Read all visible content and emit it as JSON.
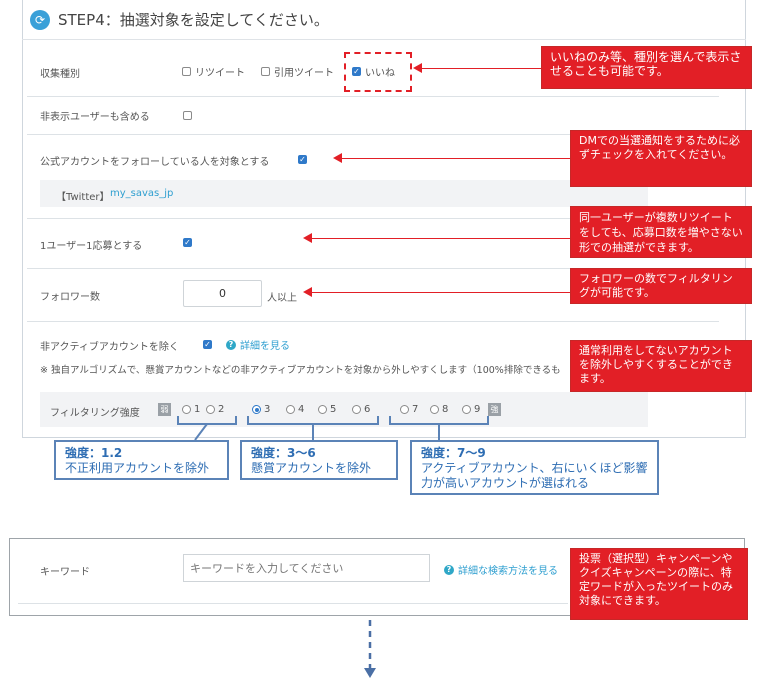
{
  "step": {
    "title": "STEP4：抽選対象を設定してください。"
  },
  "collection_type": {
    "label": "収集種別",
    "options": [
      {
        "label": "リツイート",
        "checked": false
      },
      {
        "label": "引用ツイート",
        "checked": false
      },
      {
        "label": "いいね",
        "checked": true
      }
    ]
  },
  "include_hidden": {
    "label": "非表示ユーザーも含める",
    "checked": false
  },
  "follow_official": {
    "label": "公式アカウントをフォローしている人を対象とする",
    "checked": true
  },
  "twitter": {
    "label": "【Twitter】",
    "handle": "my_savas_jp"
  },
  "one_entry": {
    "label": "1ユーザー1応募とする",
    "checked": true
  },
  "followers": {
    "label": "フォロワー数",
    "value": "0",
    "suffix": "人以上"
  },
  "inactive": {
    "label": "非アクティブアカウントを除く",
    "checked": true,
    "link": "詳細を見る",
    "note": "※ 独自アルゴリズムで、懸賞アカウントなどの非アクティブアカウントを対象から外しやすくします（100%排除できるも"
  },
  "filtering": {
    "label": "フィルタリング強度",
    "weak": "弱",
    "strong": "強",
    "levels": [
      "1",
      "2",
      "3",
      "4",
      "5",
      "6",
      "7",
      "8",
      "9"
    ],
    "selected": "3"
  },
  "keyword": {
    "label": "キーワード",
    "placeholder": "キーワードを入力してください",
    "link": "詳細な検索方法を見る"
  },
  "callouts": {
    "likes": "いいねのみ等、種別を選んで表示させることも可能です。",
    "dm": "DMでの当選通知をするために必ずチェックを入れてください。",
    "one_user": "同一ユーザーが複数リツイートをしても、応募口数を増やさない形での抽選ができます。",
    "followers": "フォロワーの数でフィルタリングが可能です。",
    "inactive": "通常利用をしてないアカウントを除外しやすくすることができます。",
    "keyword": "投票（選択型）キャンペーンやクイズキャンペーンの際に、特定ワードが入ったツイートのみ対象にできます。"
  },
  "strength_notes": [
    {
      "title": "強度：1.2",
      "body": "不正利用アカウントを除外"
    },
    {
      "title": "強度：3〜6",
      "body": "懸賞アカウントを除外"
    },
    {
      "title": "強度：7〜9",
      "body": "アクティブアカウント、右にいくほど影響力が高いアカウントが選ばれる"
    }
  ],
  "colors": {
    "accent": "#2f79c9",
    "callout_red": "#e21f26",
    "note_blue": "#2e6db3",
    "link": "#2f9fd0"
  }
}
